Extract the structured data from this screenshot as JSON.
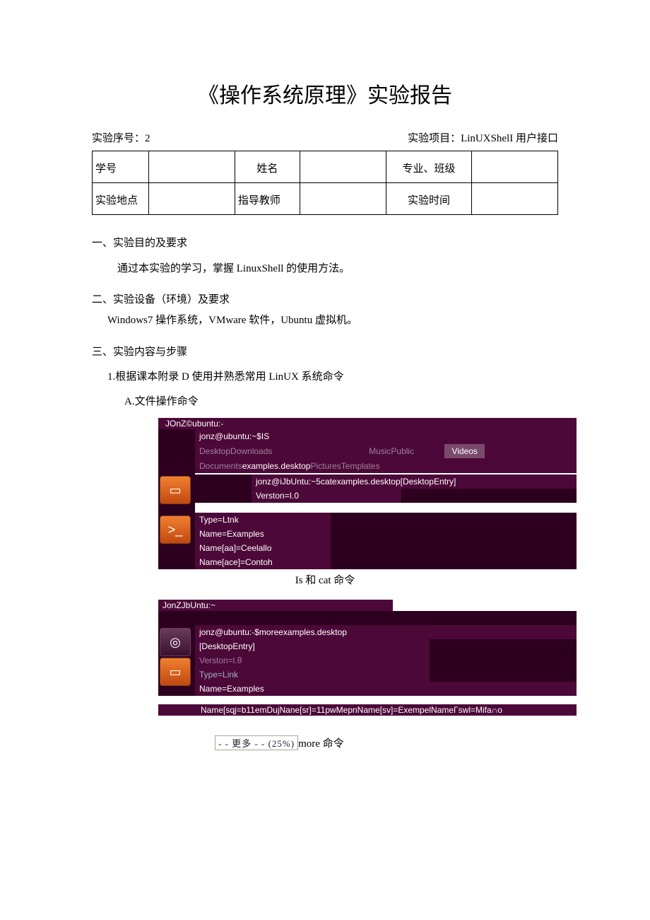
{
  "title": "《操作系统原理》实验报告",
  "meta": {
    "seq_label": "实验序号：2",
    "project_label": "实验项目：LinUXShelI 用户接口"
  },
  "info_table": {
    "r1c1": "学号",
    "r1c3": "姓名",
    "r1c5": "专业、班级",
    "r2c1": "实验地点",
    "r2c3": "指导教师",
    "r2c5": "实验时间"
  },
  "sections": {
    "s1_h": "一、实验目的及要求",
    "s1_body": "通过本实验的学习，掌握 LinuxShell 的使用方法。",
    "s2_h": "二、实验设备（环境）及要求",
    "s2_body": "Windows7 操作系统，VMware 软件，Ubuntu 虚拟机。",
    "s3_h": "三、实验内容与步骤",
    "s3_1": "1.根据课本附录 D 使用并熟悉常用 LinUX 系统命令",
    "s3_A": "A.文件操作命令"
  },
  "terminal1": {
    "title": "JOnZ©ubuntu:-",
    "l1": "jonz@ubuntu:~$IS",
    "l2a": "DesktopDownloads",
    "l2b": "MusicPublic",
    "l2c": "Videos",
    "l3a": "Documents",
    "l3b": "examples.desktop",
    "l3c": "PicturesTemplates",
    "l4": "jonz@iJbUntu:~5catexamples.desktop[DesktopEntry]",
    "l5": "Verston=I.0",
    "l6": "Type=Ltnk",
    "l7": "Name=Examples",
    "l8": "Name[aa]=Ceelallo",
    "l9": "Name[ace]=Contoh"
  },
  "caption1": "Is 和 cat 命令",
  "terminal2": {
    "title": "JonZJbUntu:~",
    "l1": "jonz@ubuntu:-$moreexamples.desktop",
    "l2": "[DesktopEntry]",
    "l3": "Verston=l.θ",
    "l4": "Type=Link",
    "l5": "Name=Examples",
    "l6": "Name[sqj=b11emDujNane[sr]=11pwMepnName[sv]=ExempelNameΓswl=Mifa∩o"
  },
  "more_badge": "- - 更多 - - (25%)",
  "caption2": "more 命令"
}
